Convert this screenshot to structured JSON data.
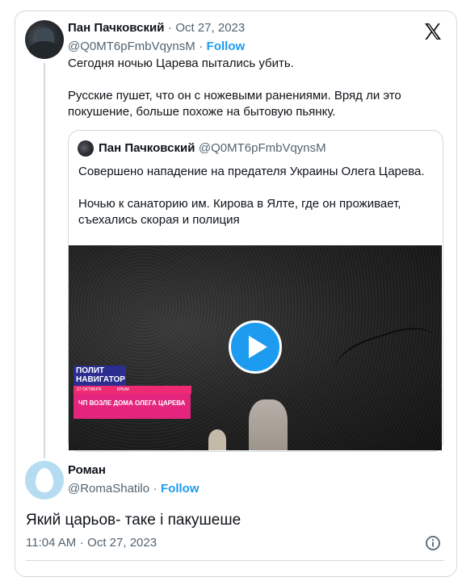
{
  "tweet": {
    "author_name": "Пан Пачковский",
    "date_separator": "·",
    "date": "Oct 27, 2023",
    "handle": "@Q0MT6pFmbVqynsM",
    "follow_separator": "·",
    "follow_label": "Follow",
    "text_line1": "Сегодня ночью Царева пытались убить.",
    "text_line2": "Русские пушет, что он с ножевыми ранениями. Вряд ли это",
    "text_line3": "покушение, больше похоже на бытовую пьянку."
  },
  "quote": {
    "author_name": "Пан Пачковский",
    "handle": "@Q0MT6pFmbVqynsM",
    "text_line1": "Совершено нападение на предателя Украины Олега Царева.",
    "text_line2": "Ночью к санаторию им. Кирова в Ялте, где он проживает,",
    "text_line3": "съехались скорая и полиция",
    "video": {
      "overlay_brand_line1": "ПОЛИТ",
      "overlay_brand_line2": "НАВИГАТОР",
      "overlay_date": "27 ОКТЯБРЯ",
      "overlay_place": "КРЫМ",
      "overlay_headline": "ЧП ВОЗЛЕ ДОМА ОЛЕГА ЦАРЕВА"
    }
  },
  "reply": {
    "author_name": "Роман",
    "handle": "@RomaShatilo",
    "follow_separator": "·",
    "follow_label": "Follow",
    "text": "Який царьов- таке і пакушеше",
    "time": "11:04 AM",
    "date_separator": "·",
    "date": "Oct 27, 2023"
  },
  "icons": {
    "logo": "x-logo-icon",
    "play": "play-icon",
    "info": "info-icon"
  },
  "colors": {
    "accent": "#1d9bf0",
    "muted": "#536471",
    "border": "#cfd9de"
  }
}
